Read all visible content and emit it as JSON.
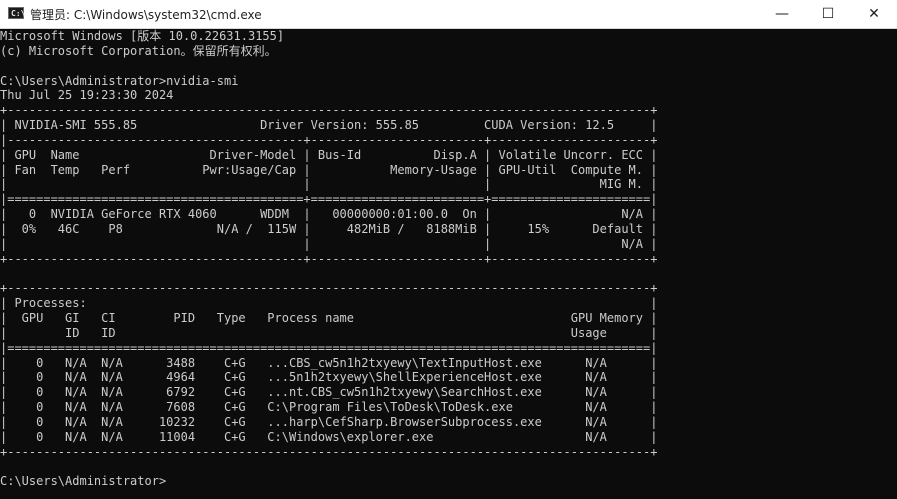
{
  "window": {
    "title": "管理员: C:\\Windows\\system32\\cmd.exe",
    "icon_glyph": "C:\\",
    "minimize_glyph": "—",
    "maximize_glyph": "☐",
    "close_glyph": "✕",
    "icons": {
      "app": "cmd-console-icon",
      "minimize": "minimize-icon",
      "maximize": "maximize-icon",
      "close": "close-icon"
    }
  },
  "colors": {
    "console_bg": "#0c0c0c",
    "console_fg": "#cccccc",
    "titlebar_bg": "#ffffff"
  },
  "console": {
    "lines": [
      "Microsoft Windows [版本 10.0.22631.3155]",
      "(c) Microsoft Corporation。保留所有权利。",
      "",
      "C:\\Users\\Administrator>nvidia-smi",
      "Thu Jul 25 19:23:30 2024",
      "+-----------------------------------------------------------------------------------------+",
      "| NVIDIA-SMI 555.85                 Driver Version: 555.85         CUDA Version: 12.5     |",
      "|-----------------------------------------+------------------------+----------------------+",
      "| GPU  Name                  Driver-Model | Bus-Id          Disp.A | Volatile Uncorr. ECC |",
      "| Fan  Temp   Perf          Pwr:Usage/Cap |           Memory-Usage | GPU-Util  Compute M. |",
      "|                                         |                        |               MIG M. |",
      "|=========================================+========================+======================|",
      "|   0  NVIDIA GeForce RTX 4060      WDDM  |   00000000:01:00.0  On |                  N/A |",
      "|  0%   46C    P8             N/A /  115W |     482MiB /   8188MiB |     15%      Default |",
      "|                                         |                        |                  N/A |",
      "+-----------------------------------------+------------------------+----------------------+",
      "",
      "+-----------------------------------------------------------------------------------------+",
      "| Processes:                                                                              |",
      "|  GPU   GI   CI        PID   Type   Process name                              GPU Memory |",
      "|        ID   ID                                                               Usage      |",
      "|=========================================================================================|",
      "|    0   N/A  N/A      3488    C+G   ...CBS_cw5n1h2txyewy\\TextInputHost.exe      N/A      |",
      "|    0   N/A  N/A      4964    C+G   ...5n1h2txyewy\\ShellExperienceHost.exe      N/A      |",
      "|    0   N/A  N/A      6792    C+G   ...nt.CBS_cw5n1h2txyewy\\SearchHost.exe      N/A      |",
      "|    0   N/A  N/A      7608    C+G   C:\\Program Files\\ToDesk\\ToDesk.exe          N/A      |",
      "|    0   N/A  N/A     10232    C+G   ...harp\\CefSharp.BrowserSubprocess.exe      N/A      |",
      "|    0   N/A  N/A     11004    C+G   C:\\Windows\\explorer.exe                     N/A      |",
      "+-----------------------------------------------------------------------------------------+",
      "",
      "C:\\Users\\Administrator>"
    ]
  }
}
